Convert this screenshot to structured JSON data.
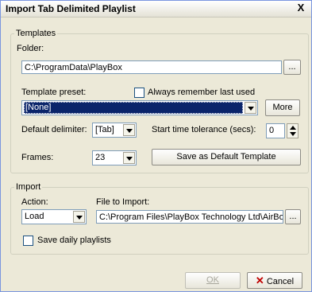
{
  "window": {
    "title": "Import Tab Delimited Playlist",
    "close_glyph": "X"
  },
  "templates": {
    "legend": "Templates",
    "folder_label": "Folder:",
    "folder_value": "C:\\ProgramData\\PlayBox",
    "browse_label": "...",
    "preset_label": "Template preset:",
    "always_remember_label": "Always remember last used",
    "preset_value": "[None]",
    "more_label": "More",
    "delimiter_label": "Default delimiter:",
    "delimiter_value": "[Tab]",
    "tolerance_label": "Start time tolerance (secs):",
    "tolerance_value": "0",
    "frames_label": "Frames:",
    "frames_value": "23",
    "save_default_label": "Save as Default Template"
  },
  "import": {
    "legend": "Import",
    "action_label": "Action:",
    "action_value": "Load",
    "file_label": "File to Import:",
    "file_value": "C:\\Program Files\\PlayBox Technology Ltd\\AirBo",
    "browse_label": "...",
    "save_daily_label": "Save daily playlists"
  },
  "footer": {
    "ok_label": "OK",
    "cancel_label": "Cancel",
    "cancel_icon": "x-icon"
  }
}
